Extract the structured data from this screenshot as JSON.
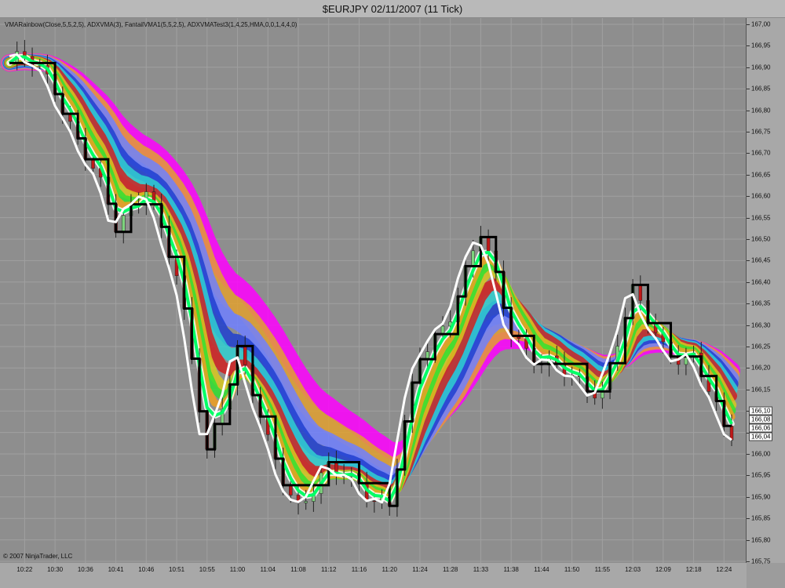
{
  "window": {
    "title": "$EURJPY  02/11/2007  (11 Tick)"
  },
  "legend": {
    "text": "VMARainbow(Close,5,5,2,5), ADXVMA(3), FantailVMA1(5,5,2,5), ADXVMATest3(1,4,25,HMA,0,0,1,4,4,0)"
  },
  "copyright": "© 2007 NinjaTrader, LLC",
  "y_axis": {
    "min": 165.75,
    "max": 167.0,
    "ticks": [
      "167,00",
      "166,95",
      "166,90",
      "166,85",
      "166,80",
      "166,75",
      "166,70",
      "166,65",
      "166,60",
      "166,55",
      "166,50",
      "166,45",
      "166,40",
      "166,35",
      "166,30",
      "166,25",
      "166,20",
      "166,15",
      "166,10",
      "166,05",
      "166,00",
      "165,95",
      "165,90",
      "165,85",
      "165,80",
      "165,75"
    ],
    "tick_values": [
      167.0,
      166.95,
      166.9,
      166.85,
      166.8,
      166.75,
      166.7,
      166.65,
      166.6,
      166.55,
      166.5,
      166.45,
      166.4,
      166.35,
      166.3,
      166.25,
      166.2,
      166.15,
      166.1,
      166.05,
      166.0,
      165.95,
      165.9,
      165.85,
      165.8,
      165.75
    ]
  },
  "x_axis": {
    "ticks": [
      "10:22",
      "10:30",
      "10:36",
      "10:41",
      "10:46",
      "10:51",
      "10:55",
      "11:00",
      "11:04",
      "11:08",
      "11:12",
      "11:16",
      "11:20",
      "11:24",
      "11:28",
      "11:33",
      "11:38",
      "11:44",
      "11:50",
      "11:55",
      "12:03",
      "12:09",
      "12:18",
      "12:24"
    ],
    "tick_index": [
      2,
      6,
      10,
      14,
      18,
      22,
      26,
      30,
      34,
      38,
      42,
      46,
      50,
      54,
      58,
      62,
      66,
      70,
      74,
      78,
      82,
      86,
      90,
      94
    ]
  },
  "price_labels": [
    "166,10",
    "166,08",
    "166,06",
    "166,04"
  ],
  "price_label_values": [
    166.1,
    166.08,
    166.06,
    166.04
  ],
  "colors": {
    "background": "#8e8e8e",
    "grid": "#a0a0a0",
    "candle_up": "#7ed37e",
    "candle_down": "#c01818",
    "adxvma": "#000000",
    "hma": "#ffffff",
    "fantail": "#00ff66",
    "rainbow": [
      "#ff00ff",
      "#e0a030",
      "#7080ff",
      "#2040d0",
      "#30d0d0",
      "#d02020",
      "#d8c820",
      "#30e030",
      "#f0a020",
      "#ffffff"
    ]
  },
  "chart_data": {
    "type": "line",
    "title": "$EURJPY  02/11/2007  (11 Tick)",
    "ylim": [
      165.75,
      167.0
    ],
    "x": [
      "10:22",
      "10:30",
      "10:36",
      "10:41",
      "10:46",
      "10:51",
      "10:55",
      "11:00",
      "11:04",
      "11:08",
      "11:12",
      "11:16",
      "11:20",
      "11:24",
      "11:28",
      "11:33",
      "11:38",
      "11:44",
      "11:50",
      "11:55",
      "12:03",
      "12:09",
      "12:18",
      "12:24"
    ],
    "series": [
      {
        "name": "Close",
        "values": [
          166.91,
          166.86,
          166.7,
          166.52,
          166.64,
          166.4,
          166.02,
          166.24,
          166.02,
          165.89,
          165.95,
          165.94,
          165.88,
          166.22,
          166.34,
          166.5,
          166.3,
          166.21,
          166.17,
          166.16,
          166.36,
          166.26,
          166.22,
          166.05
        ]
      }
    ]
  }
}
